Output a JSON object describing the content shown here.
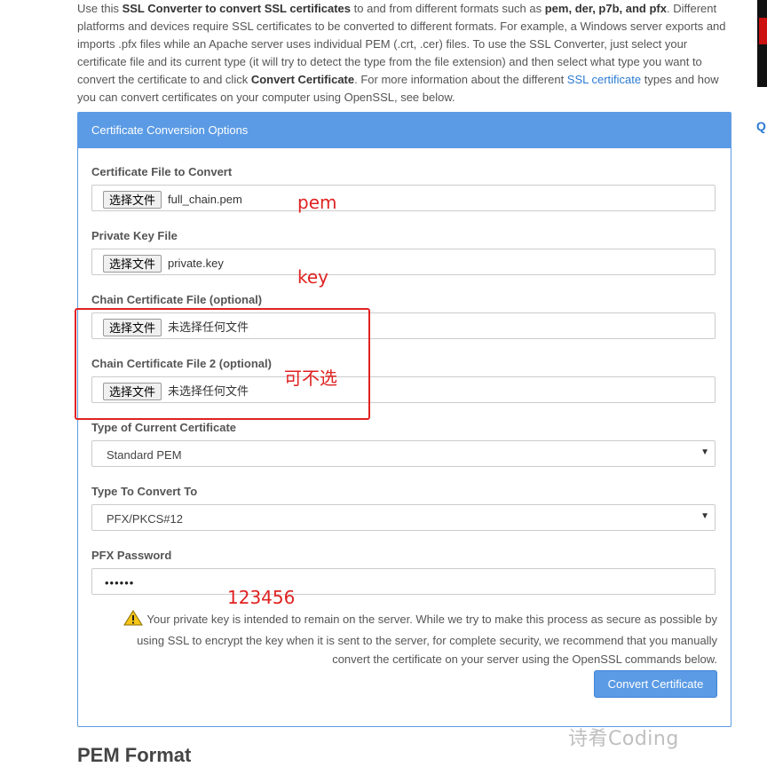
{
  "intro": {
    "t1": "Use this ",
    "b1": "SSL Converter to convert SSL certificates",
    "t2": " to and from different formats such as ",
    "b2": "pem, der, p7b, and pfx",
    "t3": ". Different platforms and devices require SSL certificates to be converted to different formats. For example, a Windows server exports and imports .pfx files while an Apache server uses individual PEM (.crt, .cer) files. To use the SSL Converter, just select your certificate file and its current type (it will try to detect the type from the file extension) and then select what type you want to convert the certificate to and click ",
    "b3": "Convert Certificate",
    "t4": ". For more information about the different ",
    "link": "SSL certificate",
    "t5": " types and how you can convert certificates on your computer using OpenSSL, see below."
  },
  "panel": {
    "title": "Certificate Conversion Options",
    "cert_label": "Certificate File to Convert",
    "cert_button": "选择文件",
    "cert_file": "full_chain.pem",
    "key_label": "Private Key File",
    "key_button": "选择文件",
    "key_file": "private.key",
    "chain_label": "Chain Certificate File (optional)",
    "chain_button": "选择文件",
    "chain_file": "未选择任何文件",
    "chain2_label": "Chain Certificate File 2 (optional)",
    "chain2_button": "选择文件",
    "chain2_file": "未选择任何文件",
    "current_type_label": "Type of Current Certificate",
    "current_type_value": "Standard PEM",
    "convert_to_label": "Type To Convert To",
    "convert_to_value": "PFX/PKCS#12",
    "pfx_label": "PFX Password",
    "pfx_value": "••••••",
    "warning": "Your private key is intended to remain on the server. While we try to make this process as secure as possible by using SSL to encrypt the key when it is sent to the server, for complete security, we recommend that you manually convert the certificate on your server using the OpenSSL commands below.",
    "convert_button": "Convert Certificate"
  },
  "annotations": {
    "pem": "pem",
    "key": "key",
    "optional": "可不选",
    "password": "123456"
  },
  "next_heading": "PEM Format",
  "sidebar": {
    "q": "Q"
  },
  "watermark": "诗肴Coding",
  "colors": {
    "panel_header": "#5b9be5",
    "annotation_red": "#e02222",
    "link": "#2a7ad2"
  }
}
